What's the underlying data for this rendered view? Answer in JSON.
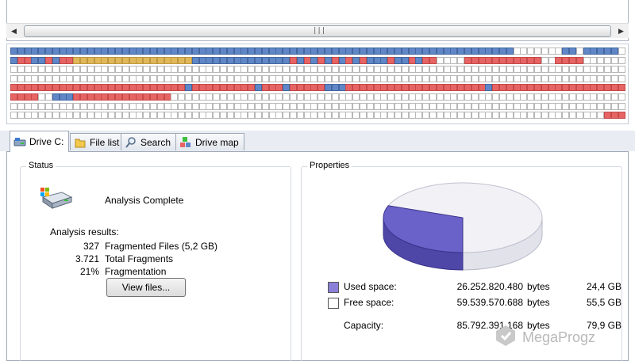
{
  "scrollbar": {
    "left_icon": "chevron-left-icon",
    "right_icon": "chevron-right-icon",
    "grip": "|||"
  },
  "blockmap": {
    "legend_colors": {
      "free": "#ffffff",
      "used": "#5f87c8",
      "fragmented": "#e66464",
      "system": "#e0b85a",
      "mft": "#9a6ec8",
      "reserved": "#e8e8e8"
    },
    "rows": [
      "1111111111111111111111111111111111111111111111111111111111111111111111110000000110111110",
      "1221121223333333333333333311111111111111212121212121112112122000022222222222002222000000",
      "0000000000000000000000000000000000000000000000000000000000000000000000000000000000000000",
      "0000000000000000000000000000000000000000000000000000000000000000000000000000000000000000",
      "2222222222222222222222222122222222212221222221112222222222222222222212222222222222222222",
      "2222001112222222222222200000000000000000000000000000000000000000000000000000000000000000",
      "0000000000000000000000000000000000000000000000000000000000000000000000000000000000000000",
      "0000000000000000000000000000000000000000000000000000000000000000000000000000000000000222"
    ]
  },
  "tabs": [
    {
      "label": "Drive C:",
      "icon": "drive-icon",
      "active": true
    },
    {
      "label": "File list",
      "icon": "folder-icon",
      "active": false
    },
    {
      "label": "Search",
      "icon": "magnifier-icon",
      "active": false
    },
    {
      "label": "Drive map",
      "icon": "blocks-icon",
      "active": false
    }
  ],
  "status": {
    "title": "Status",
    "message": "Analysis Complete",
    "results_label": "Analysis results:",
    "results": [
      {
        "value": "327",
        "label": "Fragmented Files (5,2 GB)"
      },
      {
        "value": "3.721",
        "label": "Total Fragments"
      },
      {
        "value": "21%",
        "label": "Fragmentation"
      }
    ],
    "view_button": "View files..."
  },
  "properties": {
    "title": "Properties",
    "used_fraction": 0.306,
    "colors": {
      "used": "#6a62c9",
      "free": "#f2f2f6"
    },
    "rows": [
      {
        "label": "Used space:",
        "bytes": "26.252.820.480",
        "unit": "bytes",
        "gb": "24,4 GB",
        "swatch": "#8a80d8"
      },
      {
        "label": "Free space:",
        "bytes": "59.539.570.688",
        "unit": "bytes",
        "gb": "55,5 GB",
        "swatch": "#ffffff"
      },
      {
        "label": "Capacity:",
        "bytes": "85.792.391.168",
        "unit": "bytes",
        "gb": "79,9 GB",
        "swatch": ""
      }
    ]
  },
  "watermark": "MegaProgz"
}
